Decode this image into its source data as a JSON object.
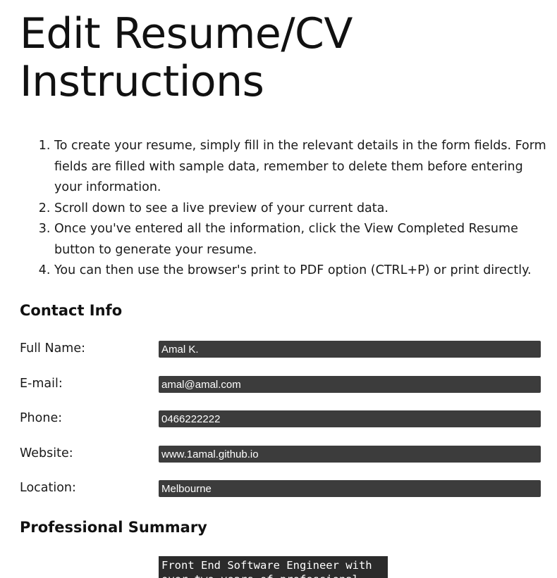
{
  "page": {
    "title_line1": "Edit Resume/CV",
    "title_line2": "Instructions"
  },
  "instructions": [
    "To create your resume, simply fill in the relevant details in the form fields. Form fields are filled with sample data, remember to delete them before entering your information.",
    "Scroll down to see a live preview of your current data.",
    "Once you've entered all the information, click the View Completed Resume button to generate your resume.",
    "You can then use the browser's print to PDF option (CTRL+P) or print directly."
  ],
  "contact": {
    "heading": "Contact Info",
    "fields": [
      {
        "label": "Full Name:",
        "value": "Amal K."
      },
      {
        "label": "E-mail:",
        "value": "amal@amal.com"
      },
      {
        "label": "Phone:",
        "value": "0466222222"
      },
      {
        "label": "Website:",
        "value": "www.1amal.github.io"
      },
      {
        "label": "Location:",
        "value": "Melbourne"
      }
    ]
  },
  "summary": {
    "heading": "Professional Summary",
    "value": "Front End Software Engineer with over two years of professional"
  },
  "colors": {
    "input_bg": "#3c3c3c",
    "input_text": "#ffffff",
    "textarea_bg": "#2b2b2b"
  }
}
